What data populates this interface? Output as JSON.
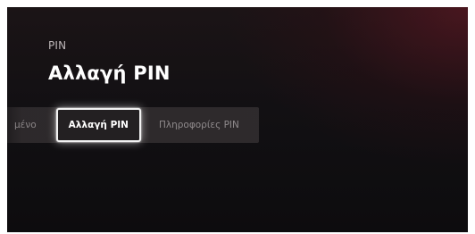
{
  "header": {
    "breadcrumb": "PIN",
    "title": "Αλλαγή PIN"
  },
  "tabs": [
    {
      "label": "μένο",
      "state": "partially-visible"
    },
    {
      "label": "Αλλαγή PIN",
      "state": "focused"
    },
    {
      "label": "Πληροφορίες PIN",
      "state": "default"
    }
  ],
  "colors": {
    "background": "#121013",
    "accent_glow": "#6e1826",
    "text_primary": "#ffffff",
    "text_secondary": "#8f8a8c",
    "focus_border": "#f2f2f2"
  }
}
